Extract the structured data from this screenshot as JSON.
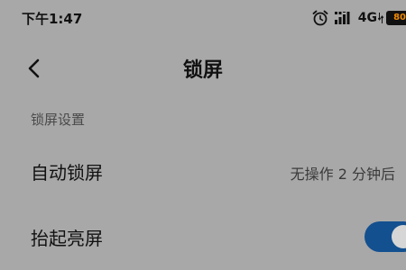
{
  "status_bar": {
    "time": "下午1:47",
    "network": "4G",
    "battery_level": "80",
    "icons": [
      "alarm-icon",
      "signal-icon",
      "network-arrows-icon",
      "battery-icon"
    ]
  },
  "header": {
    "title": "锁屏",
    "back_icon": "chevron-left-icon"
  },
  "section": {
    "title": "锁屏设置"
  },
  "settings": [
    {
      "label": "自动锁屏",
      "value": "无操作 2 分钟后"
    },
    {
      "label": "抬起亮屏",
      "toggle_on": true
    }
  ],
  "colors": {
    "background": "#a8a8a8",
    "toggle_on": "#13508f",
    "battery_text": "#f08a00"
  }
}
